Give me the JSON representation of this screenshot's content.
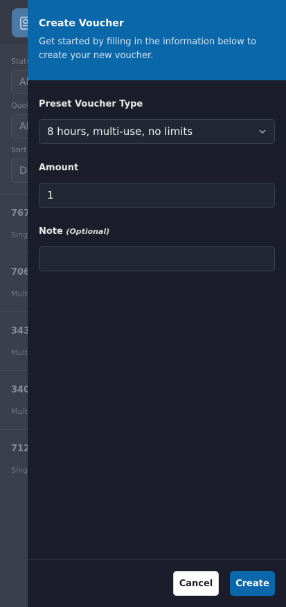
{
  "background": {
    "filters": [
      {
        "label": "Status",
        "value": "Al"
      },
      {
        "label": "Quot",
        "value": "Al"
      },
      {
        "label": "Sort",
        "value": "Da"
      }
    ],
    "rows": [
      {
        "title": "767",
        "subtitle": "Sing"
      },
      {
        "title": "706",
        "subtitle": "Multi"
      },
      {
        "title": "343",
        "subtitle": "Multi"
      },
      {
        "title": "340",
        "subtitle": "Multi"
      },
      {
        "title": "712",
        "subtitle": "Sing"
      }
    ]
  },
  "drawer": {
    "title": "Create Voucher",
    "subtitle": "Get started by filling in the information below to create your new voucher.",
    "preset": {
      "label": "Preset Voucher Type",
      "value": "8 hours, multi-use, no limits"
    },
    "amount": {
      "label": "Amount",
      "value": "1"
    },
    "note": {
      "label": "Note",
      "optional": "(Optional)",
      "value": ""
    },
    "cancel_label": "Cancel",
    "create_label": "Create"
  },
  "colors": {
    "accent": "#0a67a9",
    "drawer_bg": "#1b1e2a",
    "field_bg": "#232734"
  },
  "icons": [
    "voucher-icon",
    "chevron-down-icon"
  ]
}
